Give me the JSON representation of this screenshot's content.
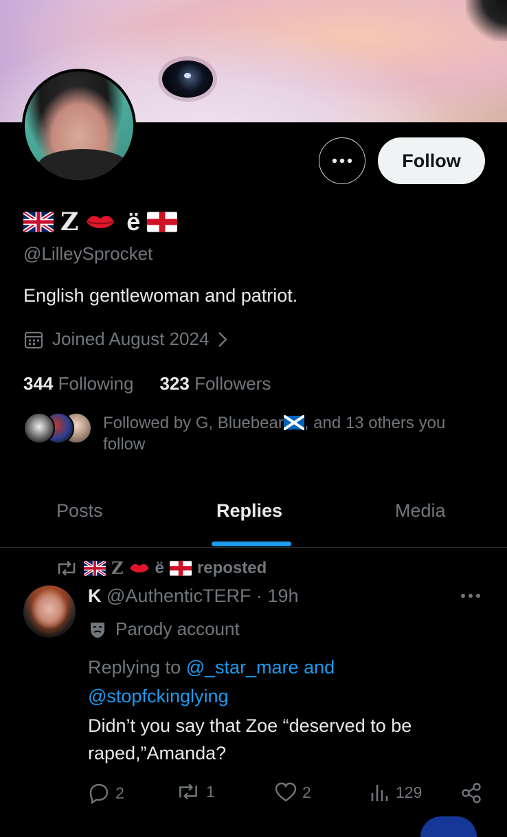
{
  "profile": {
    "display_name_letter": "Z",
    "display_name_suffix": "ë",
    "handle": "@LilleySprocket",
    "bio": "English gentlewoman and patriot.",
    "joined": "Joined August 2024",
    "following_count": "344",
    "following_label": "Following",
    "followers_count": "323",
    "followers_label": "Followers",
    "followed_by_part1": "Followed by G, Bluebear",
    "followed_by_part2": ", and 13 others you follow",
    "follow_button": "Follow"
  },
  "tabs": {
    "posts": "Posts",
    "replies": "Replies",
    "media": "Media",
    "active": "Replies"
  },
  "post": {
    "repost_name_letter": "Z",
    "repost_name_suffix": "ë",
    "repost_label": "reposted",
    "author_name": "K",
    "author_handle": "@AuthenticTERF",
    "time": "· 19h",
    "parody_label": "Parody account",
    "replying_prefix": "Replying to",
    "reply_mention_1": "@_star_mare and",
    "reply_mention_2": "@stopfckinglying",
    "text": "Didn’t you say that Zoe “deserved to be raped,”Amanda?",
    "reply_count": "2",
    "repost_count": "1",
    "like_count": "2",
    "view_count": "129"
  },
  "colors": {
    "accent": "#1d9bf0",
    "muted": "#71767b",
    "text": "#e7e9ea",
    "background": "#000000"
  },
  "icons": [
    "more-icon",
    "calendar-icon",
    "chevron-right-icon",
    "repost-icon",
    "parody-mask-icon",
    "reply-icon",
    "like-icon",
    "views-icon",
    "share-icon",
    "uk-flag-icon",
    "england-flag-icon",
    "lips-icon",
    "scotland-flag-icon"
  ]
}
